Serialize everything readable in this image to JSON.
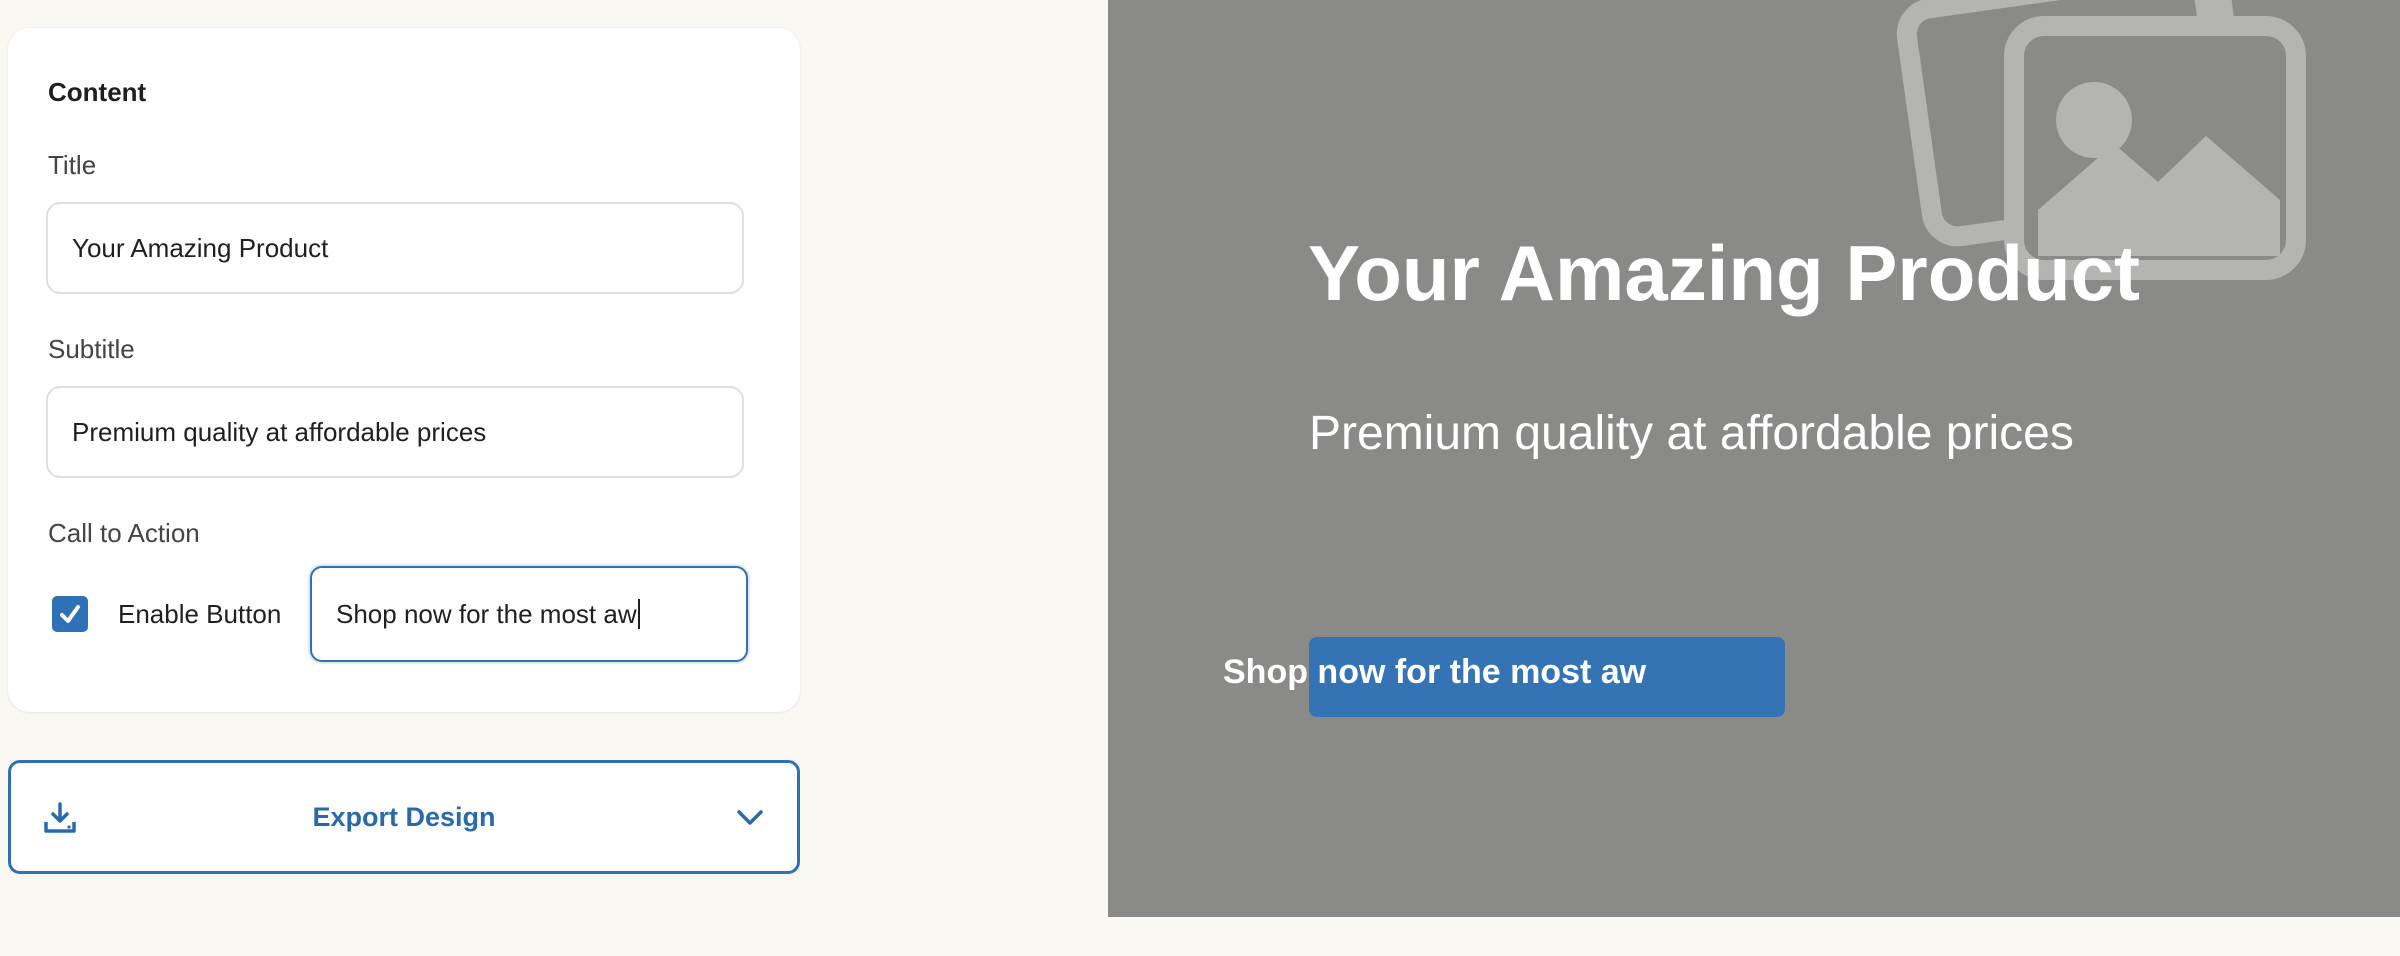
{
  "editor": {
    "section_title": "Content",
    "title_label": "Title",
    "title_value": "Your Amazing Product",
    "subtitle_label": "Subtitle",
    "subtitle_value": "Premium quality at affordable prices",
    "cta_label": "Call to Action",
    "enable_button_label": "Enable Button",
    "enable_button_checked": true,
    "cta_value": "Shop now for the most aw"
  },
  "export": {
    "label": "Export Design",
    "icon": "download-icon",
    "chevron": "chevron-down-icon"
  },
  "preview": {
    "title": "Your Amazing Product",
    "subtitle": "Premium quality at affordable prices",
    "button_text": "Shop now for the most aw",
    "background_color": "#8a8a88",
    "button_color": "#3474b5",
    "placeholder_icon": "image-placeholder-icon"
  },
  "colors": {
    "accent": "#2f71b6",
    "page_bg": "#f9f8f3"
  }
}
